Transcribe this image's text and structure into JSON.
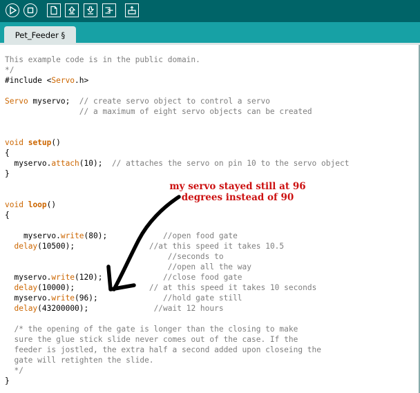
{
  "toolbar": {
    "buttons": [
      {
        "icon": "verify-icon"
      },
      {
        "icon": "stop-icon"
      },
      {
        "icon": "new-file-icon"
      },
      {
        "icon": "open-icon"
      },
      {
        "icon": "save-icon"
      },
      {
        "icon": "upload-icon"
      },
      {
        "icon": "serial-monitor-icon"
      }
    ]
  },
  "tab": {
    "label": "Pet_Feeder §"
  },
  "code_lines": [
    [
      {
        "t": "This example code is in the public domain.",
        "c": "cm"
      }
    ],
    [
      {
        "t": "*/",
        "c": "cm"
      }
    ],
    [
      {
        "t": "#include <",
        "c": ""
      },
      {
        "t": "Servo",
        "c": "kw"
      },
      {
        "t": ".h>",
        "c": ""
      }
    ],
    [
      {
        "t": "",
        "c": ""
      }
    ],
    [
      {
        "t": "Servo",
        "c": "kw"
      },
      {
        "t": " myservo;  ",
        "c": ""
      },
      {
        "t": "// create servo object to control a servo",
        "c": "cm"
      }
    ],
    [
      {
        "t": "                ",
        "c": ""
      },
      {
        "t": "// a maximum of eight servo objects can be created",
        "c": "cm"
      }
    ],
    [
      {
        "t": "",
        "c": ""
      }
    ],
    [
      {
        "t": "",
        "c": ""
      }
    ],
    [
      {
        "t": "void",
        "c": "kw"
      },
      {
        "t": " ",
        "c": ""
      },
      {
        "t": "setup",
        "c": "kwb"
      },
      {
        "t": "()",
        "c": ""
      }
    ],
    [
      {
        "t": "{",
        "c": ""
      }
    ],
    [
      {
        "t": "  myservo.",
        "c": ""
      },
      {
        "t": "attach",
        "c": "kw"
      },
      {
        "t": "(10);  ",
        "c": ""
      },
      {
        "t": "// attaches the servo on pin 10 to the servo object",
        "c": "cm"
      }
    ],
    [
      {
        "t": "}",
        "c": ""
      }
    ],
    [
      {
        "t": "",
        "c": ""
      }
    ],
    [
      {
        "t": "",
        "c": ""
      }
    ],
    [
      {
        "t": "void",
        "c": "kw"
      },
      {
        "t": " ",
        "c": ""
      },
      {
        "t": "loop",
        "c": "kwb"
      },
      {
        "t": "()",
        "c": ""
      }
    ],
    [
      {
        "t": "{",
        "c": ""
      }
    ],
    [
      {
        "t": "",
        "c": ""
      }
    ],
    [
      {
        "t": "    myservo.",
        "c": ""
      },
      {
        "t": "write",
        "c": "kw"
      },
      {
        "t": "(80);            ",
        "c": ""
      },
      {
        "t": "//open food gate",
        "c": "cm"
      }
    ],
    [
      {
        "t": "  ",
        "c": ""
      },
      {
        "t": "delay",
        "c": "kw"
      },
      {
        "t": "(10500);                ",
        "c": ""
      },
      {
        "t": "//at this speed it takes 10.5",
        "c": "cm"
      }
    ],
    [
      {
        "t": "                                   ",
        "c": ""
      },
      {
        "t": "//seconds to",
        "c": "cm"
      }
    ],
    [
      {
        "t": "                                   ",
        "c": ""
      },
      {
        "t": "//open all the way",
        "c": "cm"
      }
    ],
    [
      {
        "t": "  myservo.",
        "c": ""
      },
      {
        "t": "write",
        "c": "kw"
      },
      {
        "t": "(120);             ",
        "c": ""
      },
      {
        "t": "//close food gate",
        "c": "cm"
      }
    ],
    [
      {
        "t": "  ",
        "c": ""
      },
      {
        "t": "delay",
        "c": "kw"
      },
      {
        "t": "(10000);                ",
        "c": ""
      },
      {
        "t": "// at this speed it takes 10 seconds",
        "c": "cm"
      }
    ],
    [
      {
        "t": "  myservo.",
        "c": ""
      },
      {
        "t": "write",
        "c": "kw"
      },
      {
        "t": "(96);              ",
        "c": ""
      },
      {
        "t": "//hold gate still",
        "c": "cm"
      }
    ],
    [
      {
        "t": "  ",
        "c": ""
      },
      {
        "t": "delay",
        "c": "kw"
      },
      {
        "t": "(43200000);              ",
        "c": ""
      },
      {
        "t": "//wait 12 hours",
        "c": "cm"
      }
    ],
    [
      {
        "t": "",
        "c": ""
      }
    ],
    [
      {
        "t": "  /* the opening of the gate is longer than the closing to make",
        "c": "cm"
      }
    ],
    [
      {
        "t": "  sure the glue stick slide never comes out of the case. If the",
        "c": "cm"
      }
    ],
    [
      {
        "t": "  feeder is jostled, the extra half a second added upon closeing the",
        "c": "cm"
      }
    ],
    [
      {
        "t": "  gate will retighten the slide.",
        "c": "cm"
      }
    ],
    [
      {
        "t": "  */",
        "c": "cm"
      }
    ],
    [
      {
        "t": "}",
        "c": ""
      }
    ]
  ],
  "annotation": {
    "line1": "my servo stayed still at 96",
    "line2": "degrees instead of 90"
  },
  "colors": {
    "toolbar": "#006468",
    "tabbar": "#17a1a5",
    "comment": "#7e7e7e",
    "keyword": "#cc6600",
    "annotation": "#cc1111"
  }
}
